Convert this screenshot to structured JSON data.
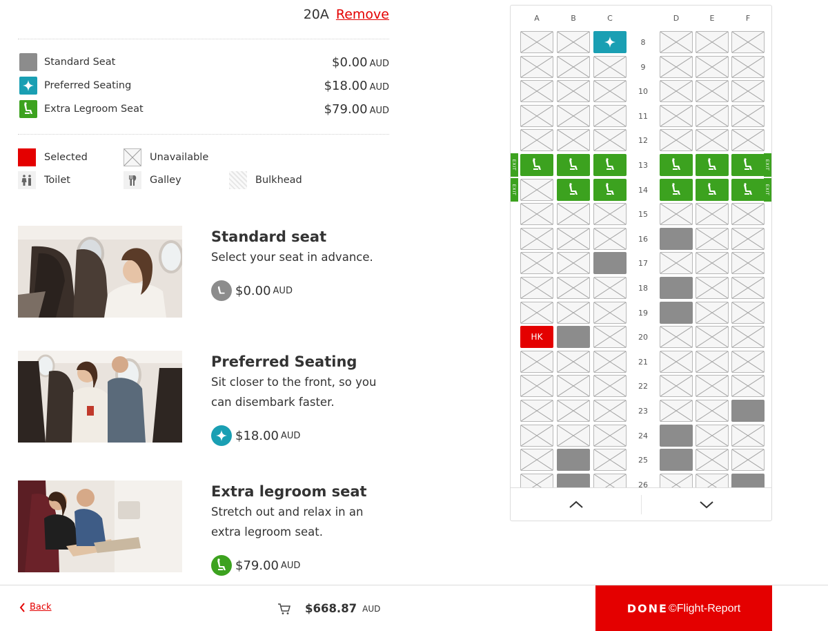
{
  "selected_seat": {
    "seat": "20A",
    "remove_label": "Remove"
  },
  "prices": [
    {
      "label": "Standard Seat",
      "amount": "$0.00",
      "currency": "AUD",
      "icon": "standard-seat"
    },
    {
      "label": "Preferred Seating",
      "amount": "$18.00",
      "currency": "AUD",
      "icon": "sparkle-icon"
    },
    {
      "label": "Extra Legroom Seat",
      "amount": "$79.00",
      "currency": "AUD",
      "icon": "legroom-seat-icon"
    }
  ],
  "legend": {
    "selected": "Selected",
    "unavailable": "Unavailable",
    "toilet": "Toilet",
    "galley": "Galley",
    "bulkhead": "Bulkhead"
  },
  "cards": [
    {
      "title": "Standard seat",
      "desc": "Select your seat in advance.",
      "price": "$0.00",
      "currency": "AUD"
    },
    {
      "title": "Preferred Seating",
      "desc": "Sit closer to the front, so you can disembark faster.",
      "price": "$18.00",
      "currency": "AUD"
    },
    {
      "title": "Extra legroom seat",
      "desc": "Stretch out and relax in an extra legroom seat.",
      "price": "$79.00",
      "currency": "AUD"
    }
  ],
  "seatmap": {
    "columns": [
      "A",
      "B",
      "C",
      "D",
      "E",
      "F"
    ],
    "exit_label": "EXIT",
    "selected_seat_label": "HK",
    "rows": [
      {
        "num": "8",
        "seats": [
          "u",
          "u",
          "p",
          "u",
          "u",
          "u"
        ]
      },
      {
        "num": "9",
        "seats": [
          "u",
          "u",
          "u",
          "u",
          "u",
          "u"
        ]
      },
      {
        "num": "10",
        "seats": [
          "u",
          "u",
          "u",
          "u",
          "u",
          "u"
        ]
      },
      {
        "num": "11",
        "seats": [
          "u",
          "u",
          "u",
          "u",
          "u",
          "u"
        ]
      },
      {
        "num": "12",
        "seats": [
          "u",
          "u",
          "u",
          "u",
          "u",
          "u"
        ]
      },
      {
        "num": "13",
        "seats": [
          "l",
          "l",
          "l",
          "l",
          "l",
          "l"
        ],
        "exit": true
      },
      {
        "num": "14",
        "seats": [
          "u",
          "l",
          "l",
          "l",
          "l",
          "l"
        ],
        "exit": true
      },
      {
        "num": "15",
        "seats": [
          "u",
          "u",
          "u",
          "u",
          "u",
          "u"
        ]
      },
      {
        "num": "16",
        "seats": [
          "u",
          "u",
          "u",
          "s",
          "u",
          "u"
        ]
      },
      {
        "num": "17",
        "seats": [
          "u",
          "u",
          "s",
          "u",
          "u",
          "u"
        ]
      },
      {
        "num": "18",
        "seats": [
          "u",
          "u",
          "u",
          "s",
          "u",
          "u"
        ]
      },
      {
        "num": "19",
        "seats": [
          "u",
          "u",
          "u",
          "s",
          "u",
          "u"
        ]
      },
      {
        "num": "20",
        "seats": [
          "x",
          "s",
          "u",
          "u",
          "u",
          "u"
        ]
      },
      {
        "num": "21",
        "seats": [
          "u",
          "u",
          "u",
          "u",
          "u",
          "u"
        ]
      },
      {
        "num": "22",
        "seats": [
          "u",
          "u",
          "u",
          "u",
          "u",
          "u"
        ]
      },
      {
        "num": "23",
        "seats": [
          "u",
          "u",
          "u",
          "u",
          "u",
          "s"
        ]
      },
      {
        "num": "24",
        "seats": [
          "u",
          "u",
          "u",
          "s",
          "u",
          "u"
        ]
      },
      {
        "num": "25",
        "seats": [
          "u",
          "s",
          "u",
          "s",
          "u",
          "u"
        ]
      },
      {
        "num": "26",
        "seats": [
          "u",
          "s",
          "u",
          "u",
          "u",
          "s"
        ]
      }
    ]
  },
  "colors": {
    "accent": "#e40000",
    "standard": "#8c8c8c",
    "preferred": "#1a9fb3",
    "legroom": "#3ca21f"
  },
  "bottom": {
    "back_label": "Back",
    "total": "$668.87",
    "currency": "AUD",
    "done_label": "DONE",
    "watermark": "©Flight-Report"
  }
}
